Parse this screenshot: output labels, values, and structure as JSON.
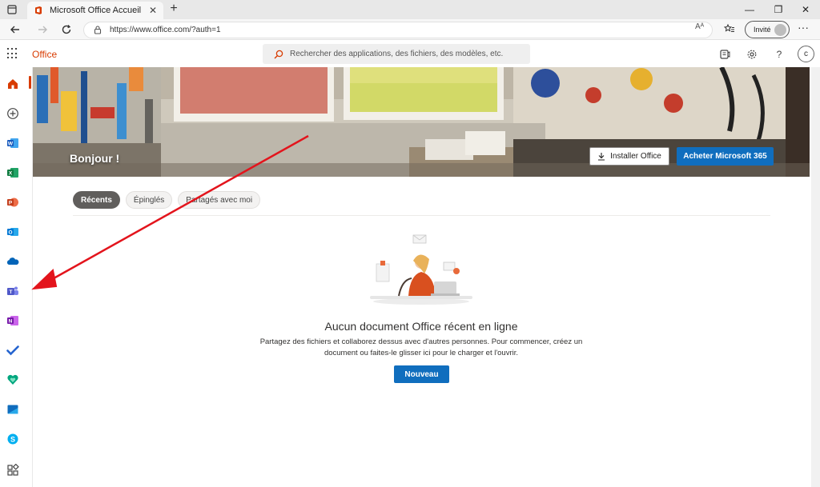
{
  "browser": {
    "tab_title": "Microsoft Office Accueil",
    "tab_close": "✕",
    "new_tab": "+",
    "window_controls": [
      "—",
      "❐",
      "✕"
    ],
    "url": "https://www.office.com/?auth=1",
    "read_aloud": "Aᴬ",
    "guest_label": "Invité",
    "more_menu": "···"
  },
  "office_header": {
    "app_name": "Office",
    "search_placeholder": "Rechercher des applications, des fichiers, des modèles, etc.",
    "help": "?",
    "user_initial": "c"
  },
  "rail": {
    "items": [
      {
        "name": "home-icon",
        "color": "#d83b01"
      },
      {
        "name": "create-icon",
        "color": "#444444"
      },
      {
        "name": "word-icon",
        "color": "#185abd"
      },
      {
        "name": "excel-icon",
        "color": "#107c41"
      },
      {
        "name": "powerpoint-icon",
        "color": "#c43e1c"
      },
      {
        "name": "outlook-icon",
        "color": "#0078d4"
      },
      {
        "name": "onedrive-icon",
        "color": "#0364b8"
      },
      {
        "name": "teams-icon",
        "color": "#5059c9"
      },
      {
        "name": "onenote-icon",
        "color": "#7719aa"
      },
      {
        "name": "todo-icon",
        "color": "#2564cf"
      },
      {
        "name": "family-safety-icon",
        "color": "#00a67e"
      },
      {
        "name": "calendar-icon",
        "color": "#0f6cbd"
      },
      {
        "name": "skype-icon",
        "color": "#00aff0"
      },
      {
        "name": "all-apps-icon",
        "color": "#444444"
      }
    ]
  },
  "hero": {
    "greeting": "Bonjour !",
    "install_label": "Installer Office",
    "buy_label": "Acheter Microsoft 365"
  },
  "tabs": [
    {
      "label": "Récents",
      "active": true
    },
    {
      "label": "Épinglés",
      "active": false
    },
    {
      "label": "Partagés avec moi",
      "active": false
    }
  ],
  "empty_state": {
    "title": "Aucun document Office récent en ligne",
    "line1": "Partagez des fichiers et collaborez dessus avec d'autres personnes. Pour commencer, créez un",
    "line2": "document ou faites-le glisser ici pour le charger et l'ouvrir.",
    "new_button": "Nouveau"
  },
  "colors": {
    "accent": "#d83b01",
    "primary_button": "#106ebe",
    "annotation_arrow": "#e3141c"
  }
}
